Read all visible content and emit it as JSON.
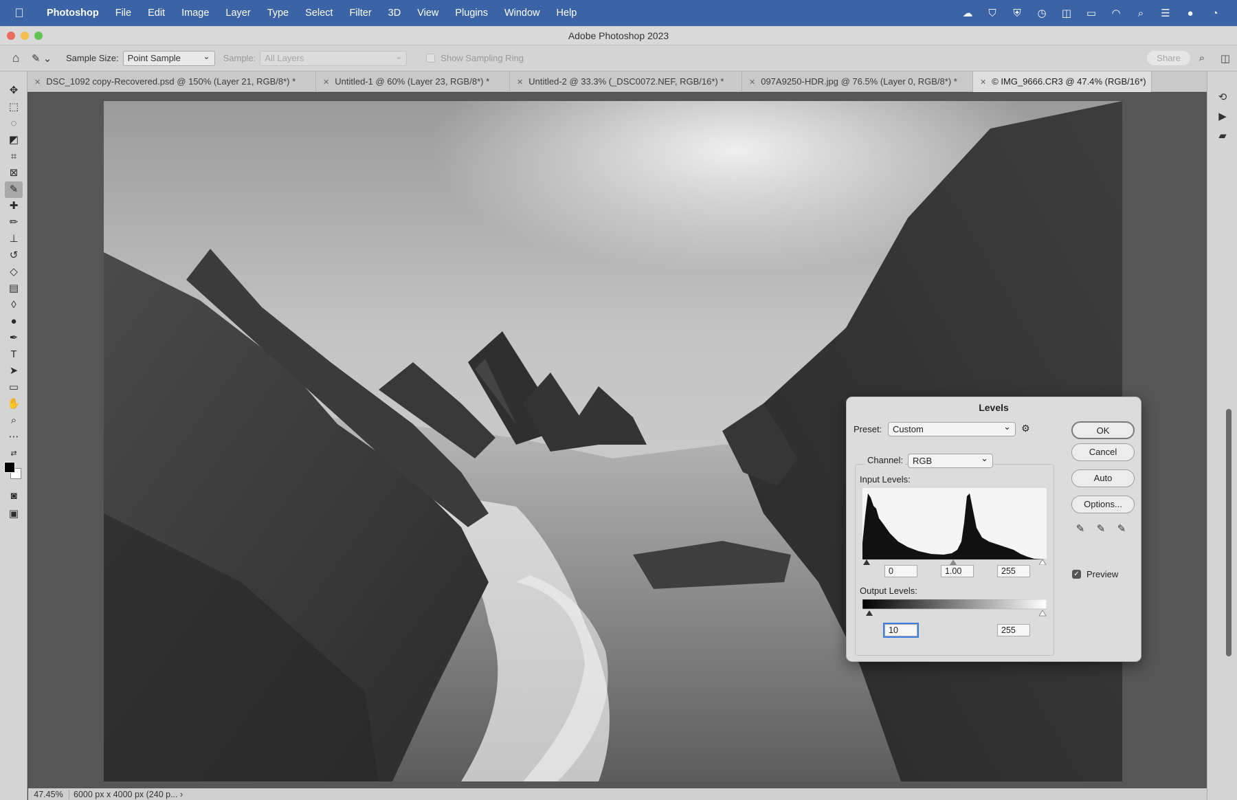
{
  "menubar": {
    "app_name": "Photoshop",
    "items": [
      "File",
      "Edit",
      "Image",
      "Layer",
      "Type",
      "Select",
      "Filter",
      "3D",
      "View",
      "Plugins",
      "Window",
      "Help"
    ],
    "status_icons": [
      "creative-cloud-icon",
      "location-icon",
      "vpn-icon",
      "time-machine-icon",
      "display-icon",
      "battery-icon",
      "wifi-icon",
      "spotlight-icon",
      "control-center-icon",
      "siri-icon",
      "screen-time-icon"
    ]
  },
  "window": {
    "title": "Adobe Photoshop 2023"
  },
  "options_bar": {
    "sample_size_label": "Sample Size:",
    "sample_size_value": "Point Sample",
    "sample_label": "Sample:",
    "sample_value": "All Layers",
    "show_sampling_ring_label": "Show Sampling Ring",
    "share_label": "Share"
  },
  "tabs": [
    {
      "label": "DSC_1092 copy-Recovered.psd @ 150% (Layer 21, RGB/8*) *"
    },
    {
      "label": "Untitled-1 @ 60% (Layer 23, RGB/8*) *"
    },
    {
      "label": "Untitled-2 @ 33.3% (_DSC0072.NEF, RGB/16*) *"
    },
    {
      "label": "097A9250-HDR.jpg @ 76.5% (Layer 0, RGB/8*) *"
    },
    {
      "label": "© IMG_9666.CR3 @ 47.4% (RGB/16*)"
    }
  ],
  "status_bar": {
    "zoom": "47.45%",
    "info": "6000 px x 4000 px (240 p...",
    "arrow": "›"
  },
  "levels_dialog": {
    "title": "Levels",
    "preset_label": "Preset:",
    "preset_value": "Custom",
    "channel_label": "Channel:",
    "channel_value": "RGB",
    "input_levels_label": "Input Levels:",
    "input_black": "0",
    "input_gamma": "1.00",
    "input_white": "255",
    "output_levels_label": "Output Levels:",
    "output_black": "10",
    "output_white": "255",
    "ok_label": "OK",
    "cancel_label": "Cancel",
    "auto_label": "Auto",
    "options_label": "Options...",
    "preview_label": "Preview",
    "preview_checked": true,
    "check_mark": "✓"
  },
  "colors": {
    "menubar_bg": "#3a64a6",
    "chrome_bg": "#d4d4d4",
    "canvas_bg": "#565656",
    "focus_ring": "#3d7fe0"
  }
}
